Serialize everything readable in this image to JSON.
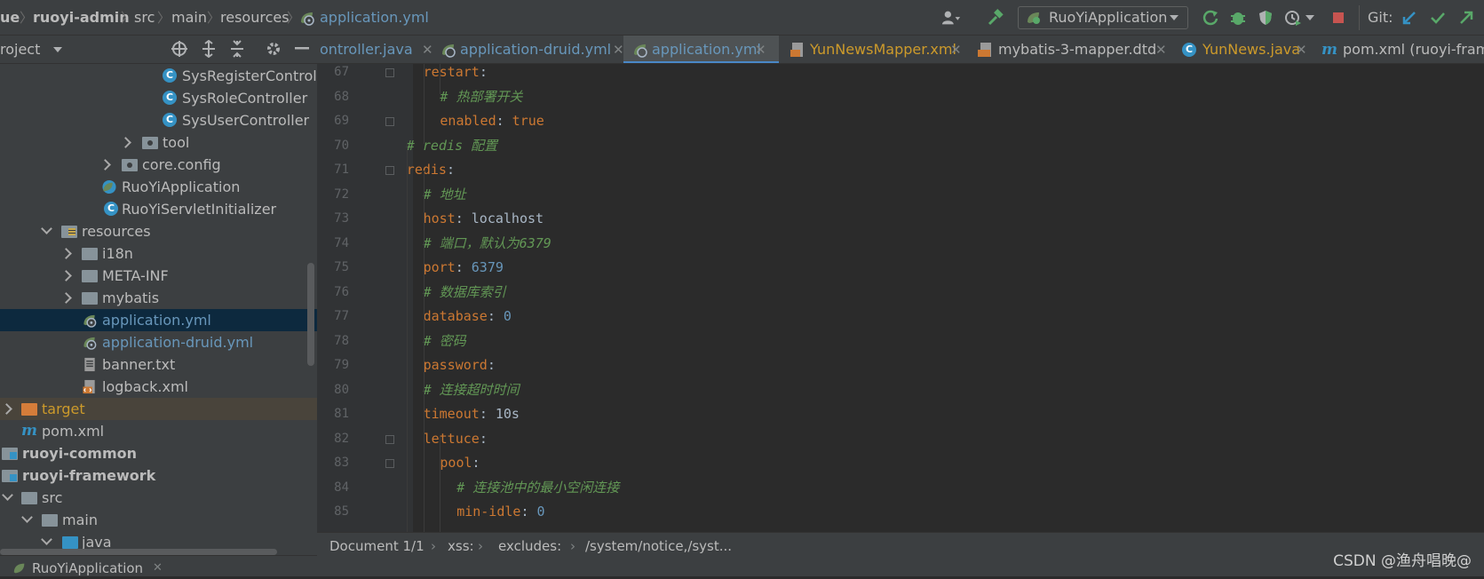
{
  "navbar": {
    "breadcrumbs": [
      "ue",
      "ruoyi-admin",
      "src",
      "main",
      "resources",
      "application.yml"
    ],
    "run_config": "RuoYiApplication",
    "git_label": "Git:"
  },
  "project_panel": {
    "title": "roject"
  },
  "tree": [
    {
      "label": "SysRegisterControlle",
      "kind": "class"
    },
    {
      "label": "SysRoleController",
      "kind": "class"
    },
    {
      "label": "SysUserController",
      "kind": "class"
    },
    {
      "label": "tool",
      "kind": "package"
    },
    {
      "label": "core.config",
      "kind": "package"
    },
    {
      "label": "RuoYiApplication",
      "kind": "spring-class"
    },
    {
      "label": "RuoYiServletInitializer",
      "kind": "class"
    },
    {
      "label": "resources",
      "kind": "resources-folder"
    },
    {
      "label": "i18n",
      "kind": "folder"
    },
    {
      "label": "META-INF",
      "kind": "folder"
    },
    {
      "label": "mybatis",
      "kind": "folder"
    },
    {
      "label": "application.yml",
      "kind": "yml"
    },
    {
      "label": "application-druid.yml",
      "kind": "yml"
    },
    {
      "label": "banner.txt",
      "kind": "text-file"
    },
    {
      "label": "logback.xml",
      "kind": "xml-file"
    },
    {
      "label": "target",
      "kind": "excluded-folder"
    },
    {
      "label": "pom.xml",
      "kind": "maven-file"
    },
    {
      "label": "ruoyi-common",
      "kind": "module"
    },
    {
      "label": "ruoyi-framework",
      "kind": "module"
    },
    {
      "label": "src",
      "kind": "folder"
    },
    {
      "label": "main",
      "kind": "folder"
    },
    {
      "label": "java",
      "kind": "source-folder"
    }
  ],
  "tabs": [
    {
      "label": "ontroller.java"
    },
    {
      "label": "application-druid.yml"
    },
    {
      "label": "application.yml"
    },
    {
      "label": "YunNewsMapper.xml"
    },
    {
      "label": "mybatis-3-mapper.dtd"
    },
    {
      "label": "YunNews.java"
    },
    {
      "label": "pom.xml (ruoyi-frame"
    }
  ],
  "editor": {
    "lines": [
      {
        "num": "67",
        "indent": 2,
        "parts": [
          {
            "t": "restart",
            "c": "k"
          },
          {
            "t": ":",
            "c": "p"
          }
        ]
      },
      {
        "num": "68",
        "indent": 3,
        "parts": [
          {
            "t": "# 热部署开关",
            "c": "c"
          }
        ]
      },
      {
        "num": "69",
        "indent": 3,
        "parts": [
          {
            "t": "enabled",
            "c": "k"
          },
          {
            "t": ": ",
            "c": "p"
          },
          {
            "t": "true",
            "c": "k"
          }
        ]
      },
      {
        "num": "70",
        "indent": 1,
        "parts": [
          {
            "t": "# redis 配置",
            "c": "c"
          }
        ]
      },
      {
        "num": "71",
        "indent": 1,
        "parts": [
          {
            "t": "redis",
            "c": "k"
          },
          {
            "t": ":",
            "c": "p"
          }
        ]
      },
      {
        "num": "72",
        "indent": 2,
        "parts": [
          {
            "t": "# 地址",
            "c": "c"
          }
        ]
      },
      {
        "num": "73",
        "indent": 2,
        "parts": [
          {
            "t": "host",
            "c": "k"
          },
          {
            "t": ": localhost",
            "c": "p"
          }
        ]
      },
      {
        "num": "74",
        "indent": 2,
        "parts": [
          {
            "t": "# 端口，默认为6379",
            "c": "c"
          }
        ]
      },
      {
        "num": "75",
        "indent": 2,
        "parts": [
          {
            "t": "port",
            "c": "k"
          },
          {
            "t": ": ",
            "c": "p"
          },
          {
            "t": "6379",
            "c": "n"
          }
        ]
      },
      {
        "num": "76",
        "indent": 2,
        "parts": [
          {
            "t": "# 数据库索引",
            "c": "c"
          }
        ]
      },
      {
        "num": "77",
        "indent": 2,
        "parts": [
          {
            "t": "database",
            "c": "k"
          },
          {
            "t": ": ",
            "c": "p"
          },
          {
            "t": "0",
            "c": "n"
          }
        ]
      },
      {
        "num": "78",
        "indent": 2,
        "parts": [
          {
            "t": "# 密码",
            "c": "c"
          }
        ]
      },
      {
        "num": "79",
        "indent": 2,
        "parts": [
          {
            "t": "password",
            "c": "k"
          },
          {
            "t": ":",
            "c": "p"
          }
        ]
      },
      {
        "num": "80",
        "indent": 2,
        "parts": [
          {
            "t": "# 连接超时时间",
            "c": "c"
          }
        ]
      },
      {
        "num": "81",
        "indent": 2,
        "parts": [
          {
            "t": "timeout",
            "c": "k"
          },
          {
            "t": ": 10s",
            "c": "p"
          }
        ]
      },
      {
        "num": "82",
        "indent": 2,
        "parts": [
          {
            "t": "lettuce",
            "c": "k"
          },
          {
            "t": ":",
            "c": "p"
          }
        ]
      },
      {
        "num": "83",
        "indent": 3,
        "parts": [
          {
            "t": "pool",
            "c": "k"
          },
          {
            "t": ":",
            "c": "p"
          }
        ]
      },
      {
        "num": "84",
        "indent": 4,
        "parts": [
          {
            "t": "# 连接池中的最小空闲连接",
            "c": "c"
          }
        ]
      },
      {
        "num": "85",
        "indent": 4,
        "parts": [
          {
            "t": "min-idle",
            "c": "k"
          },
          {
            "t": ": ",
            "c": "p"
          },
          {
            "t": "0",
            "c": "n"
          }
        ]
      }
    ]
  },
  "statusbar": {
    "document": "Document 1/1",
    "path1": "xss:",
    "path2": "excludes:",
    "path3": "/system/notice,/syst..."
  },
  "bottom": {
    "run_tab": "RuoYiApplication"
  },
  "watermark": "CSDN @渔舟唱晚@"
}
